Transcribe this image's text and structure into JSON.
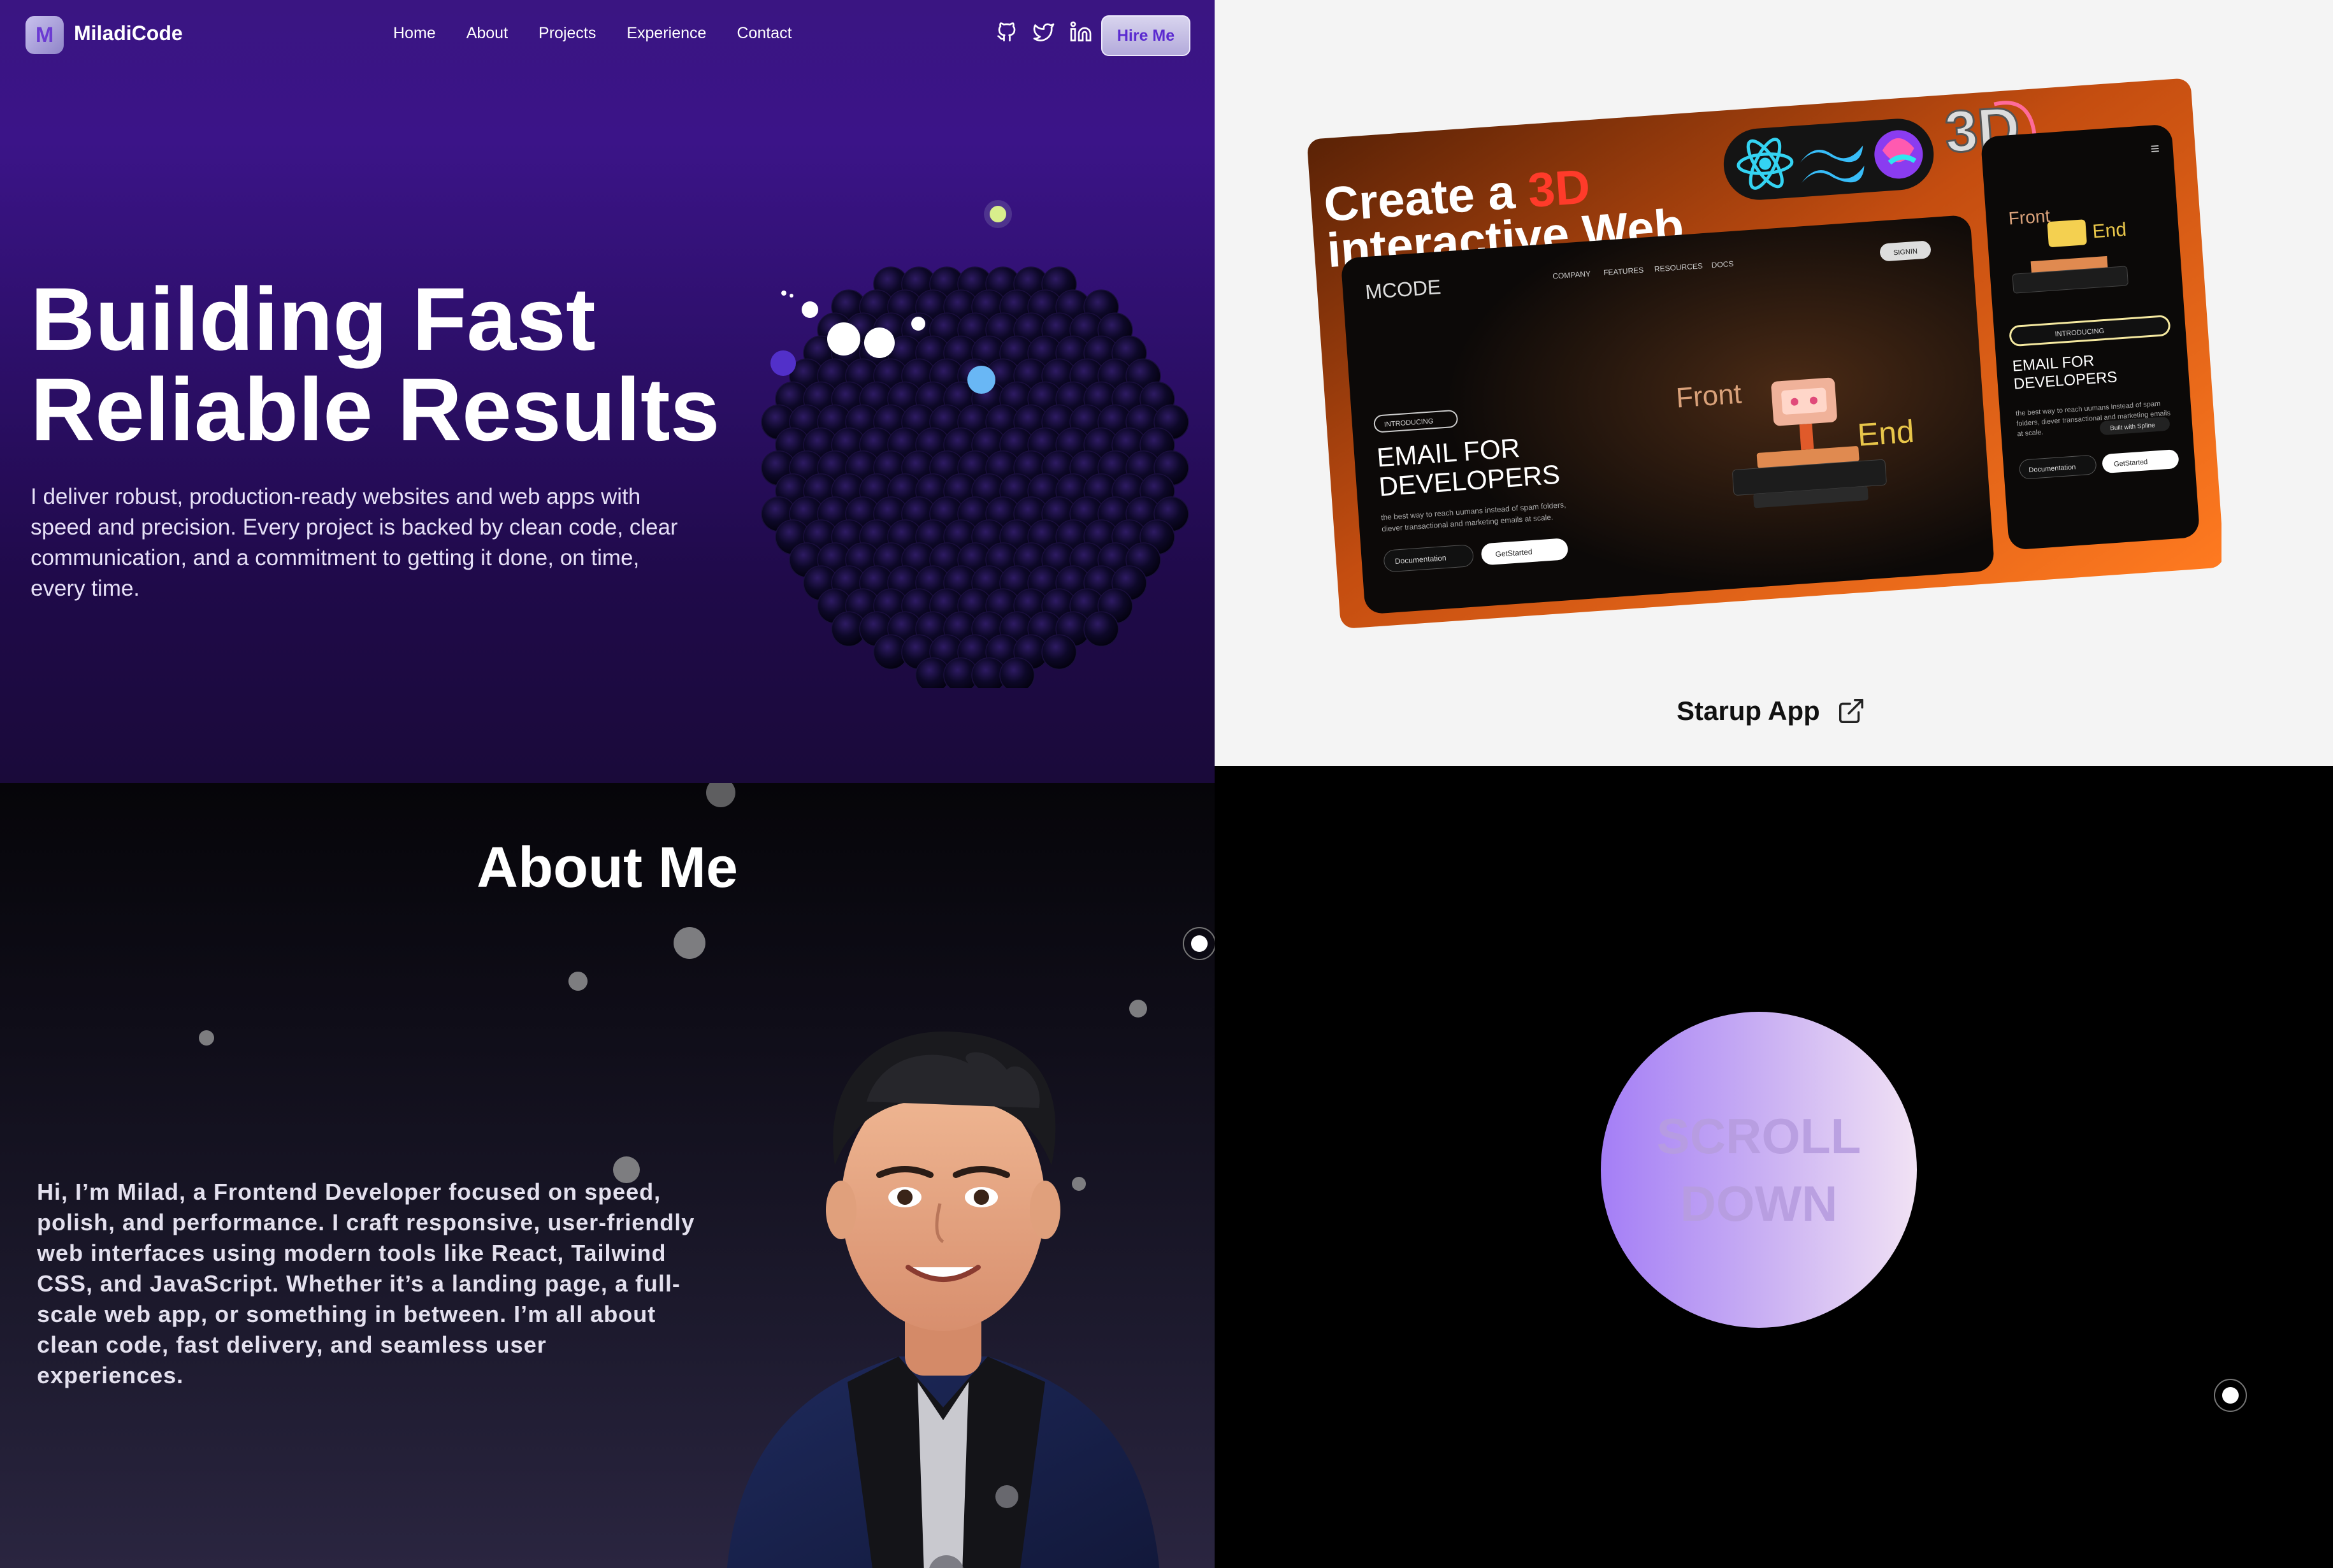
{
  "nav": {
    "logo_letter": "M",
    "brand": "MiladiCode",
    "links": [
      "Home",
      "About",
      "Projects",
      "Experience",
      "Contact"
    ],
    "social_icons": [
      "github-icon",
      "twitter-icon",
      "linkedin-icon"
    ],
    "cta": "Hire Me"
  },
  "hero": {
    "title_line1": "Building Fast",
    "title_line2": "Reliable Results",
    "subtitle": "I deliver robust, production-ready websites and web apps with speed and precision. Every project is backed by clean code, clear communication, and a commitment to getting it done, on time, every time."
  },
  "project": {
    "name": "Starup App",
    "link_icon": "external-link-icon",
    "mock": {
      "headline_part1": "Create a ",
      "headline_accent": "3D",
      "headline_part2": "interactive Web",
      "badge_3d": "3D",
      "brand": "MCODE",
      "menu": [
        "COMPANY",
        "FEATURES",
        "RESOURCES",
        "DOCS"
      ],
      "signin": "SIGNIN",
      "introducing": "INTRODUCING",
      "heading_line1": "EMAIL FOR",
      "heading_line2": "DEVELOPERS",
      "body_line1": "the best way to reach uumans instead of spam folders,",
      "body_line2": "diever transactional and marketing emails at scale.",
      "btn_docs": "Documentation",
      "btn_start": "GetStarted",
      "front": "Front",
      "end": "End",
      "side_body_line1": "the best way to reach uumans instead of spam",
      "side_body_line2": "folders, diever transactional and marketing emails",
      "side_body_line3": "at scale.",
      "spline": "Built with Spline",
      "accent": "#f5602a"
    }
  },
  "about": {
    "title": "About Me",
    "text": "Hi, I’m Milad, a Frontend Developer focused on speed, polish, and performance. I craft responsive, user-friendly web interfaces using modern tools like React, Tailwind CSS, and JavaScript. Whether it’s a landing page, a full-scale web app, or something in between. I’m all about clean code, fast delivery, and seamless user experiences."
  },
  "scroll": {
    "line1": "SCROLL",
    "line2": "DOWN"
  },
  "colors": {
    "hero_purple": "#3b1488",
    "cta_text": "#5b2bd0",
    "scroll_gradient_start": "#a47ef6",
    "scroll_gradient_end": "#f1e2f4"
  }
}
